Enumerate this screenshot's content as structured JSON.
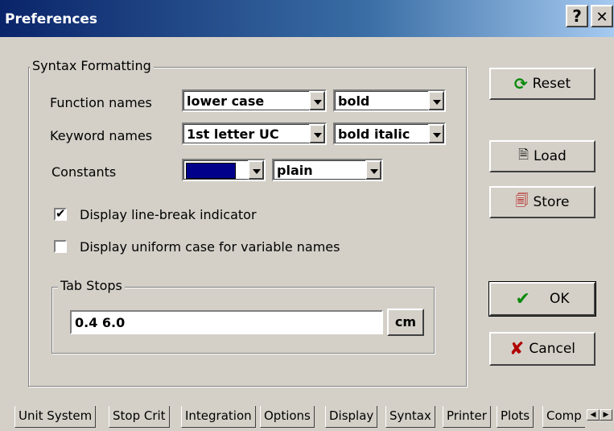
{
  "window": {
    "title": "Preferences",
    "help_label": "?",
    "close_label": "✕"
  },
  "syntax": {
    "group_label": "Syntax Formatting",
    "function_names": {
      "label": "Function names",
      "case": "lower case",
      "style": "bold"
    },
    "keyword_names": {
      "label": "Keyword names",
      "case": "1st letter UC",
      "style": "bold italic"
    },
    "constants": {
      "label": "Constants",
      "color": "#00008b",
      "style": "plain"
    },
    "linebreak": {
      "label": "Display line-break indicator",
      "checked": true
    },
    "uniform_case": {
      "label": "Display uniform case for variable names",
      "checked": false
    }
  },
  "tabstops": {
    "group_label": "Tab Stops",
    "value": "0.4 6.0",
    "unit": "cm"
  },
  "buttons": {
    "reset": "Reset",
    "load": "Load",
    "store": "Store",
    "ok": "OK",
    "cancel": "Cancel"
  },
  "tabs": [
    "Unit System",
    "Stop Crit",
    "Integration",
    "Options",
    "Display",
    "Syntax",
    "Printer",
    "Plots",
    "Comp"
  ],
  "active_tab": "Syntax"
}
